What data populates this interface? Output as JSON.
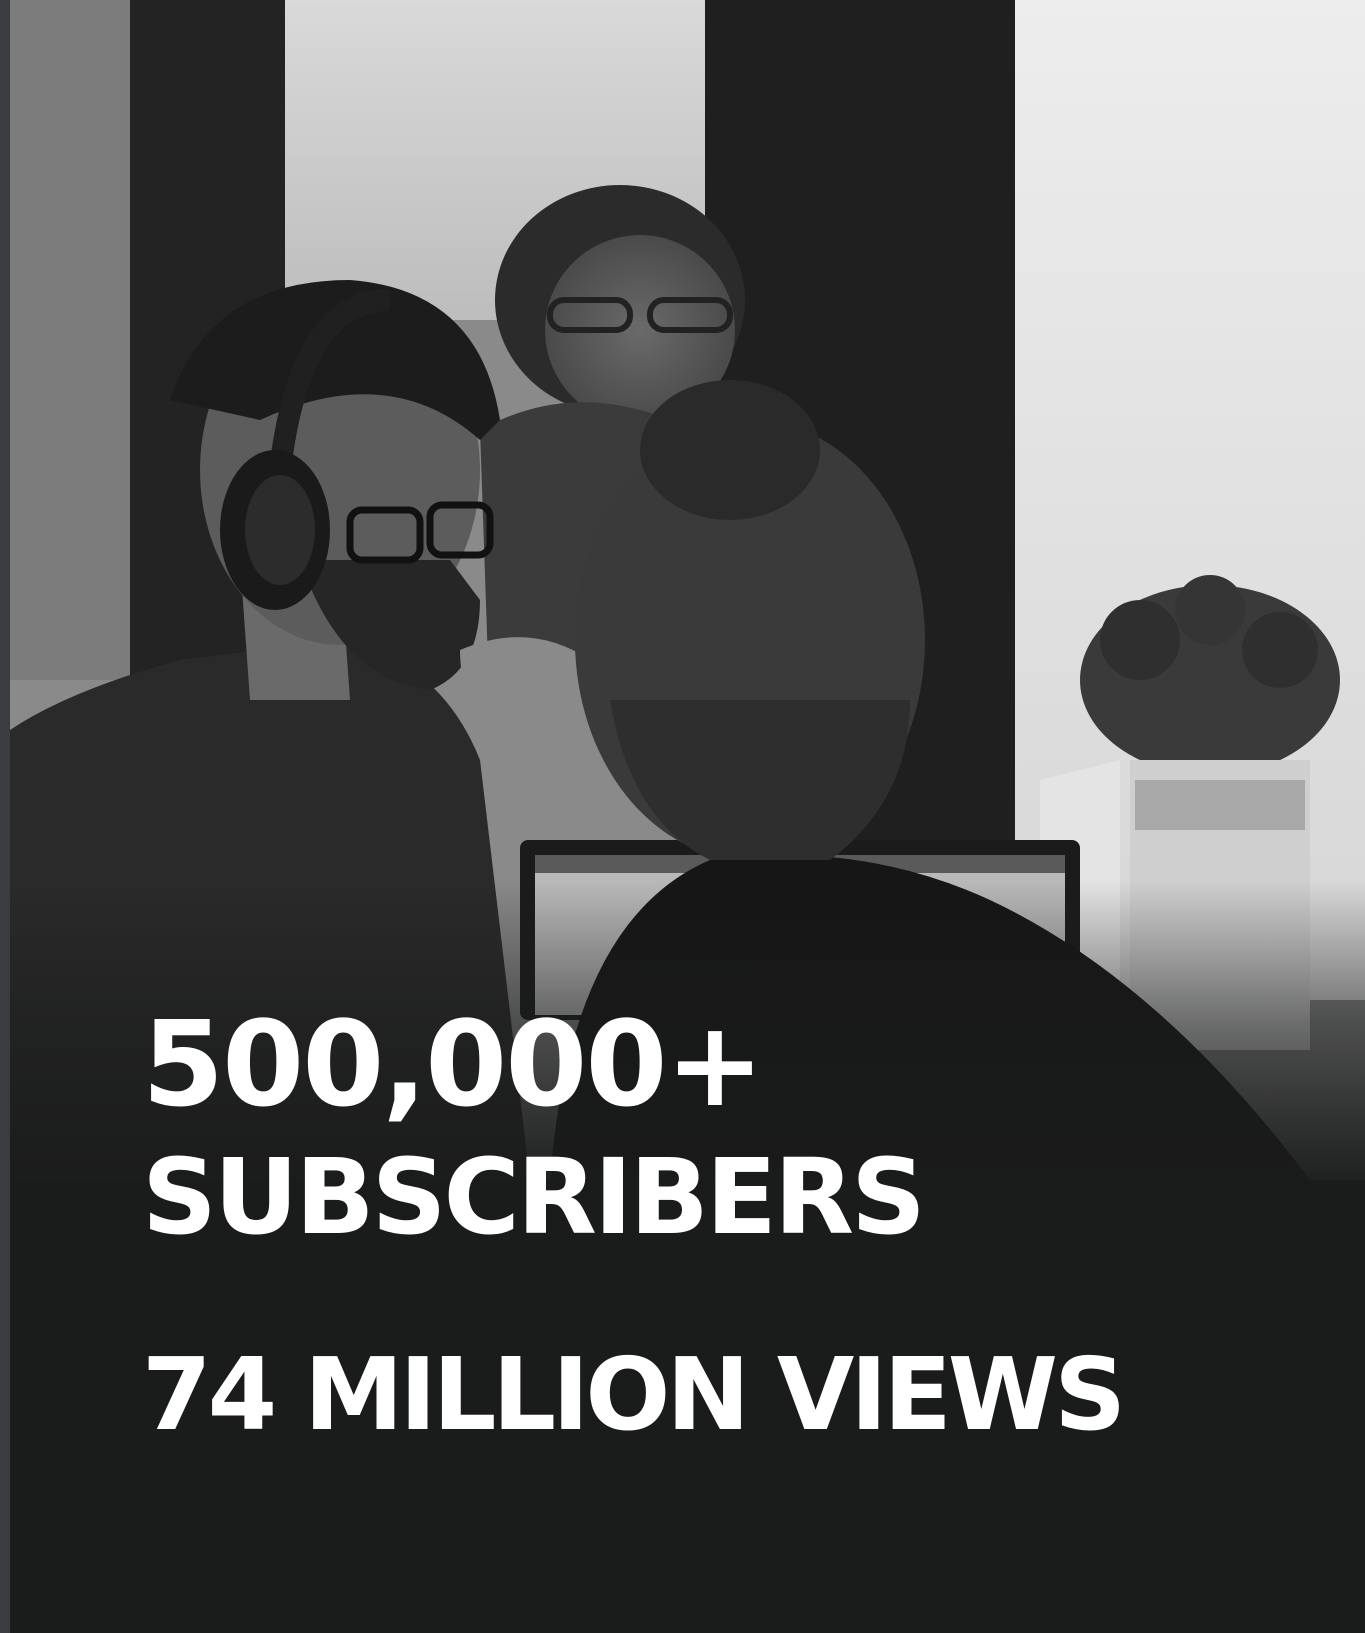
{
  "colors": {
    "background": "#1a1b1b",
    "text": "#ffffff",
    "left_strip": "#3b3c40"
  },
  "photo": {
    "description_icon": "office-photo-illustration"
  },
  "stats": {
    "subscribers_count": "500,000+",
    "subscribers_label": "SUBSCRIBERS",
    "views": "74 MILLION VIEWS"
  }
}
